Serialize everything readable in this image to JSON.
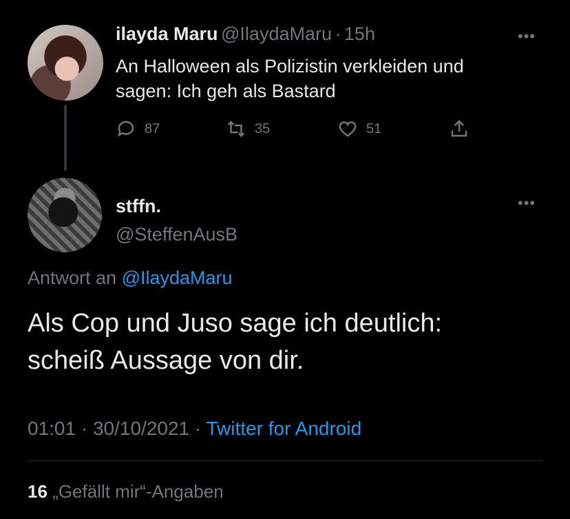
{
  "parent_tweet": {
    "author_name": "ilayda Maru",
    "author_handle": "@IlaydaMaru",
    "separator": "·",
    "time": "15h",
    "text_line1": "An Halloween als Polizistin verkleiden und",
    "text_line2": "sagen: Ich geh als Bastard",
    "reply_count": "87",
    "retweet_count": "35",
    "like_count": "51",
    "more": "•••"
  },
  "reply_tweet": {
    "author_name": "stffn.",
    "author_handle": "@SteffenAusB",
    "more": "•••",
    "replying_to_prefix": "Antwort an",
    "replying_to_handle": "@IlaydaMaru",
    "text_line1": "Als Cop und Juso sage ich deutlich:",
    "text_line2": "scheiß Aussage von dir.",
    "time": "01:01",
    "date": "30/10/2021",
    "dot1": "·",
    "dot2": "·",
    "source": "Twitter for Android"
  },
  "likes": {
    "count": "16",
    "label": "„Gefällt mir“-Angaben"
  }
}
